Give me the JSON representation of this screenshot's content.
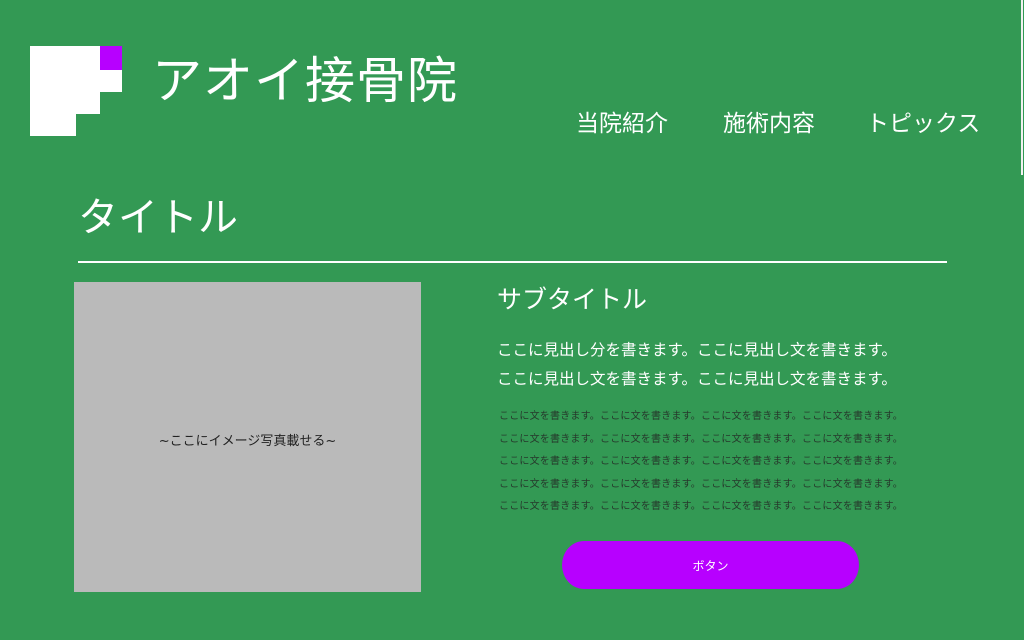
{
  "brand": {
    "name": "アオイ接骨院",
    "logo_icon": "step-blocks-logo",
    "logo_color": "#ffffff",
    "logo_accent_color": "#b700ff"
  },
  "nav": {
    "items": [
      {
        "label": "当院紹介"
      },
      {
        "label": "施術内容"
      },
      {
        "label": "トピックス"
      }
    ]
  },
  "section": {
    "title": "タイトル",
    "image_placeholder": "~ここにイメージ写真載せる~",
    "subtitle": "サブタイトル",
    "lead_lines": [
      "ここに見出し分を書きます。ここに見出し文を書きます。",
      "ここに見出し文を書きます。ここに見出し文を書きます。"
    ],
    "body_lines": [
      "ここに文を書きます。ここに文を書きます。ここに文を書きます。ここに文を書きます。",
      "ここに文を書きます。ここに文を書きます。ここに文を書きます。ここに文を書きます。",
      "ここに文を書きます。ここに文を書きます。ここに文を書きます。ここに文を書きます。",
      "ここに文を書きます。ここに文を書きます。ここに文を書きます。ここに文を書きます。",
      "ここに文を書きます。ここに文を書きます。ここに文を書きます。ここに文を書きます。"
    ],
    "button_label": "ボタン"
  },
  "colors": {
    "background": "#339954",
    "text": "#ffffff",
    "accent": "#b700ff",
    "image_placeholder_bg": "#bababa"
  }
}
